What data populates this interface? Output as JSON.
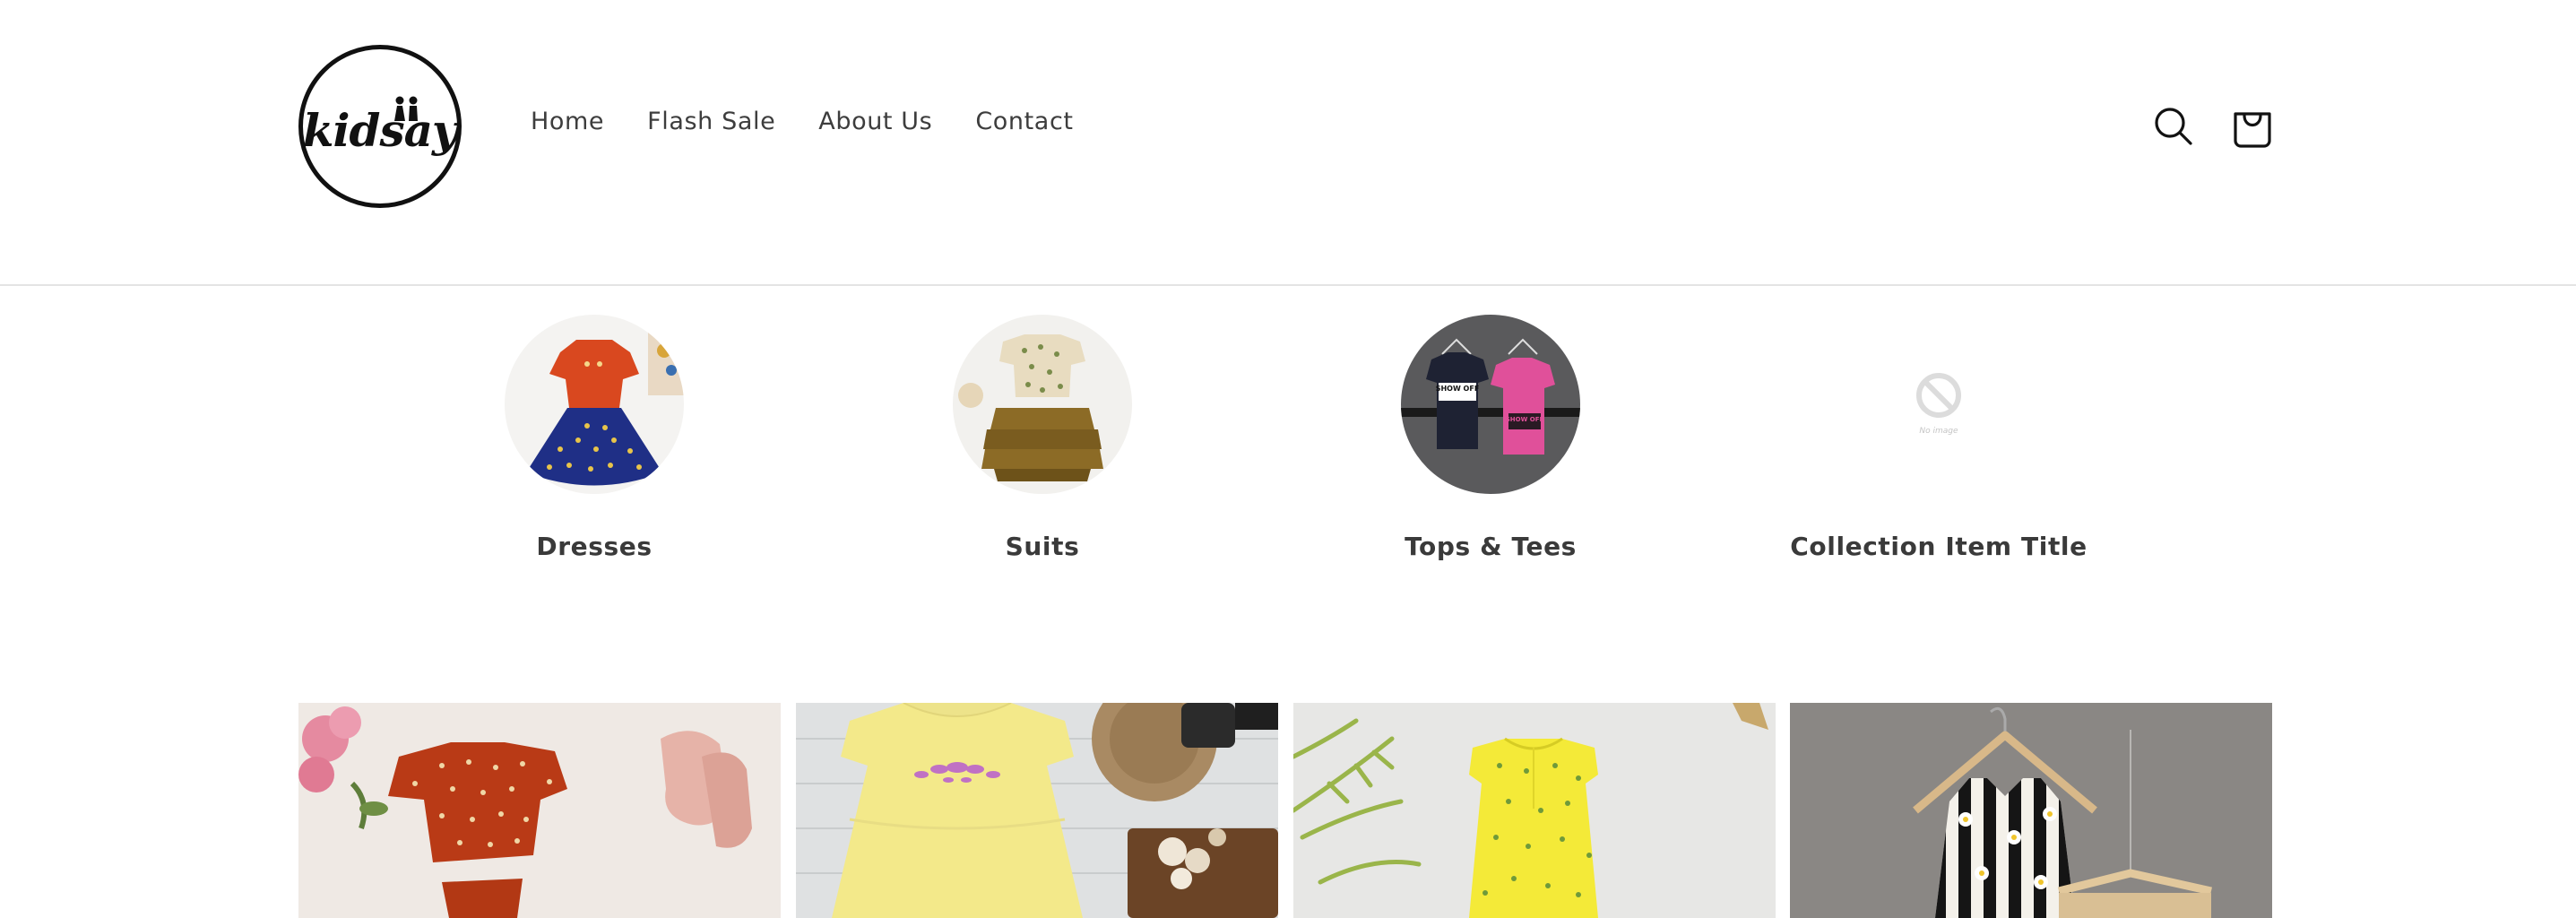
{
  "header": {
    "logo_text": "kidsay",
    "nav": [
      {
        "label": "Home"
      },
      {
        "label": "Flash Sale"
      },
      {
        "label": "About Us"
      },
      {
        "label": "Contact"
      }
    ],
    "icons": {
      "search": "search-icon",
      "cart": "cart-icon"
    }
  },
  "collections": [
    {
      "title": "Dresses",
      "image": "dresses-image"
    },
    {
      "title": "Suits",
      "image": "suits-image"
    },
    {
      "title": "Tops & Tees",
      "image": "tops-tees-image",
      "shirt_text_1": "SHOW OFF",
      "shirt_text_2": "SHOW OFF"
    },
    {
      "title": "Collection Item Title",
      "image": "no-image-placeholder",
      "placeholder_text": "No image"
    }
  ],
  "products": [
    {
      "image": "red-floral-outfit-photo"
    },
    {
      "image": "yellow-embroidered-dress-photo"
    },
    {
      "image": "yellow-floral-dress-photo"
    },
    {
      "image": "striped-daisy-dress-photo"
    }
  ],
  "colors": {
    "border": "#e4e4e4",
    "text": "#3d3d3d",
    "heading": "#3a3a3a"
  }
}
